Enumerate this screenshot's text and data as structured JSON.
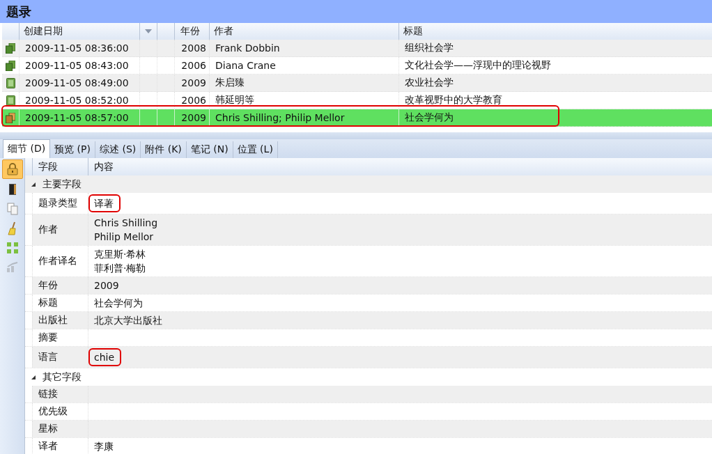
{
  "title": "题录",
  "list": {
    "columns": [
      "创建日期",
      "年份",
      "作者",
      "标题"
    ],
    "rows": [
      {
        "kind": "books",
        "date": "2009-11-05 08:36:00",
        "year": "2008",
        "author": "Frank Dobbin",
        "title": "组织社会学",
        "selected": false,
        "circled": false
      },
      {
        "kind": "books",
        "date": "2009-11-05 08:43:00",
        "year": "2006",
        "author": "Diana Crane",
        "title": "文化社会学——浮现中的理论视野",
        "selected": false,
        "circled": false
      },
      {
        "kind": "book",
        "date": "2009-11-05 08:49:00",
        "year": "2009",
        "author": "朱启臻",
        "title": "农业社会学",
        "selected": false,
        "circled": false
      },
      {
        "kind": "book",
        "date": "2009-11-05 08:52:00",
        "year": "2006",
        "author": "韩延明等",
        "title": "改革视野中的大学教育",
        "selected": false,
        "circled": false
      },
      {
        "kind": "books",
        "date": "2009-11-05 08:57:00",
        "year": "2009",
        "author": "Chris Shilling; Philip Mellor",
        "title": "社会学何为",
        "selected": true,
        "circled": true
      }
    ]
  },
  "tabs": [
    {
      "label": "细节 (D)",
      "selected": true
    },
    {
      "label": "预览 (P)",
      "selected": false
    },
    {
      "label": "综述 (S)",
      "selected": false
    },
    {
      "label": "附件 (K)",
      "selected": false
    },
    {
      "label": "笔记 (N)",
      "selected": false
    },
    {
      "label": "位置 (L)",
      "selected": false
    }
  ],
  "toolbar": [
    {
      "kind": "lock",
      "selected": true,
      "disabled": false
    },
    {
      "kind": "door",
      "selected": false,
      "disabled": false
    },
    {
      "kind": "copy",
      "selected": false,
      "disabled": false
    },
    {
      "kind": "broom",
      "selected": false,
      "disabled": false
    },
    {
      "kind": "grid",
      "selected": false,
      "disabled": false
    },
    {
      "kind": "chart",
      "selected": false,
      "disabled": true
    }
  ],
  "details": {
    "columns": [
      "字段",
      "内容"
    ],
    "groups": [
      {
        "label": "主要字段",
        "expanded": true,
        "children": [
          {
            "field": "题录类型",
            "values": [
              "译著"
            ],
            "circled": true
          },
          {
            "field": "作者",
            "values": [
              "Chris Shilling",
              "Philip Mellor"
            ],
            "circled": false
          },
          {
            "field": "作者译名",
            "values": [
              "克里斯·希林",
              "菲利普·梅勒"
            ],
            "circled": false
          },
          {
            "field": "年份",
            "values": [
              "2009"
            ],
            "circled": false
          },
          {
            "field": "标题",
            "values": [
              "社会学何为"
            ],
            "circled": false
          },
          {
            "field": "出版社",
            "values": [
              "北京大学出版社"
            ],
            "circled": false
          },
          {
            "field": "摘要",
            "circled": false
          },
          {
            "field": "语言",
            "values": [
              "chie"
            ],
            "circled": true
          }
        ]
      },
      {
        "label": "其它字段",
        "expanded": true,
        "children": [
          {
            "field": "链接",
            "circled": false
          },
          {
            "field": "优先级",
            "circled": false
          },
          {
            "field": "星标",
            "circled": false
          },
          {
            "field": "译者",
            "values": [
              "李康"
            ],
            "circled": false
          }
        ]
      }
    ]
  }
}
